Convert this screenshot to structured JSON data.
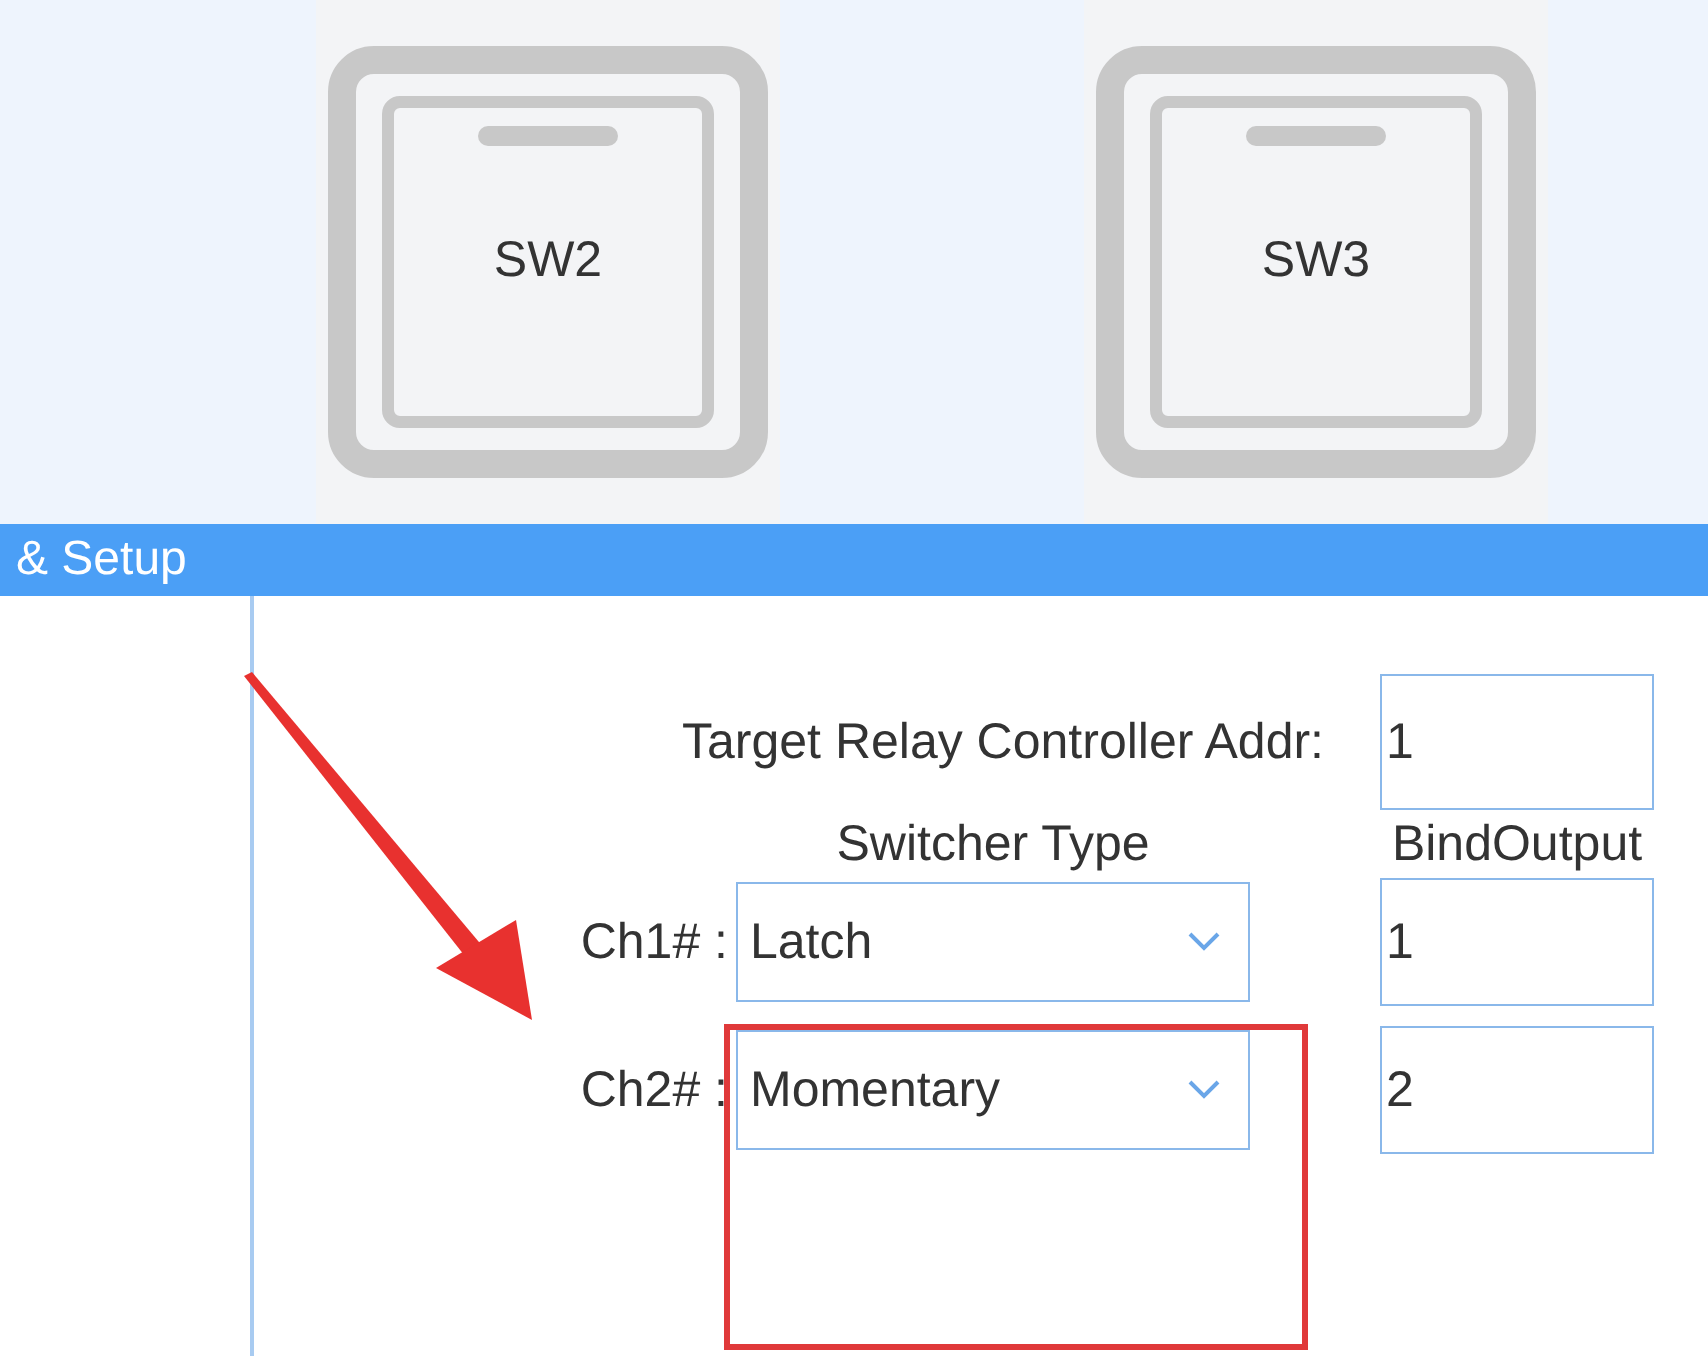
{
  "switches": [
    {
      "label": "SW2"
    },
    {
      "label": "SW3"
    }
  ],
  "section": {
    "title": "& Setup"
  },
  "target_addr": {
    "label": "Target Relay Controller Addr:",
    "value": "1"
  },
  "columns": [
    "Switcher Type",
    "BindOutput"
  ],
  "channels": [
    {
      "label": "Ch1# :",
      "type": "Latch",
      "bind_output": "1"
    },
    {
      "label": "Ch2# :",
      "type": "Momentary",
      "bind_output": "2"
    }
  ]
}
